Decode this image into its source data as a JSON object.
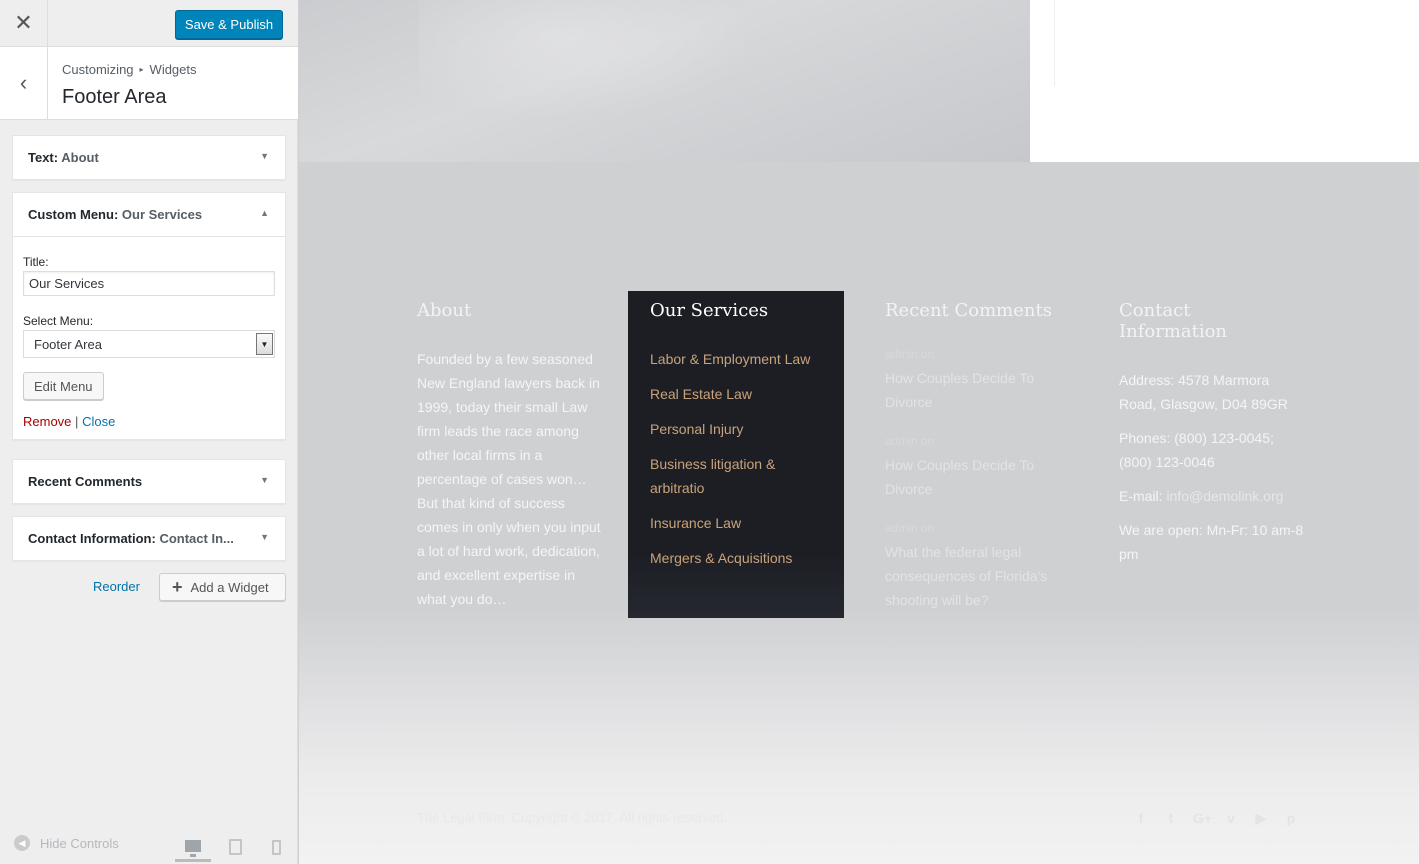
{
  "topbar": {
    "close_glyph": "✕",
    "publish_label": "Save & Publish"
  },
  "section": {
    "back_glyph": "‹",
    "breadcrumb_root": "Customizing",
    "breadcrumb_sep": "▸",
    "breadcrumb_leaf": "Widgets",
    "title": "Footer Area"
  },
  "widgets": [
    {
      "type": "Text",
      "sep": ": ",
      "name": "About",
      "expanded": false
    },
    {
      "type": "Custom Menu",
      "sep": ": ",
      "name": "Our Services",
      "expanded": true
    },
    {
      "type": "Recent Comments",
      "sep": "",
      "name": "",
      "expanded": false
    },
    {
      "type": "Contact Information",
      "sep": ": ",
      "name": "Contact In...",
      "expanded": false
    }
  ],
  "menu_form": {
    "title_label": "Title:",
    "title_value": "Our Services",
    "select_label": "Select Menu:",
    "select_value": "Footer Area",
    "edit_menu_label": "Edit Menu",
    "remove_label": "Remove",
    "divider": "|",
    "close_label": "Close"
  },
  "actions": {
    "reorder_label": "Reorder",
    "add_widget_label": "Add a Widget",
    "add_glyph": "+"
  },
  "footer_controls": {
    "hide_label": "Hide Controls",
    "active_device": "desktop"
  },
  "preview": {
    "about": {
      "heading": "About",
      "body": "Founded by a few seasoned New England lawyers back in 1999, today their small Law firm leads the race among other local firms in a percentage of cases won…But that kind of success comes in only when you input a lot of hard work, dedication, and excellent expertise in what you do…"
    },
    "services": {
      "heading": "Our Services",
      "items": [
        "Labor & Employment Law",
        "Real Estate Law",
        "Personal Injury",
        "Business litigation & arbitratio",
        "Insurance Law",
        "Mergers & Acquisitions"
      ]
    },
    "comments": {
      "heading": "Recent Comments",
      "items": [
        {
          "meta": "admin  on",
          "title": "How Couples Decide To Divorce"
        },
        {
          "meta": "admin  on",
          "title": "How Couples Decide To Divorce"
        },
        {
          "meta": "admin  on",
          "title": "What the federal legal consequences of Florida's shooting will be?"
        }
      ]
    },
    "contact": {
      "heading": "Contact Information",
      "address": "Address: 4578 Marmora Road, Glasgow, D04 89GR",
      "phones": "Phones: (800) 123-0045; (800) 123-0046",
      "email_label": "E-mail: ",
      "email": "info@demolink.org",
      "hours": "We are open: Mn-Fr: 10 am-8 pm"
    },
    "copyright": "The Legal Firm. Copyright © 2017. All rights reserved.",
    "socials": [
      "f",
      "t",
      "G+",
      "v",
      "▶",
      "p"
    ]
  },
  "colors": {
    "primary_button": "#0085ba",
    "link": "#0073aa",
    "remove": "#aa0000",
    "services_bg": "#1c1e24",
    "services_link": "#c9a37b"
  }
}
